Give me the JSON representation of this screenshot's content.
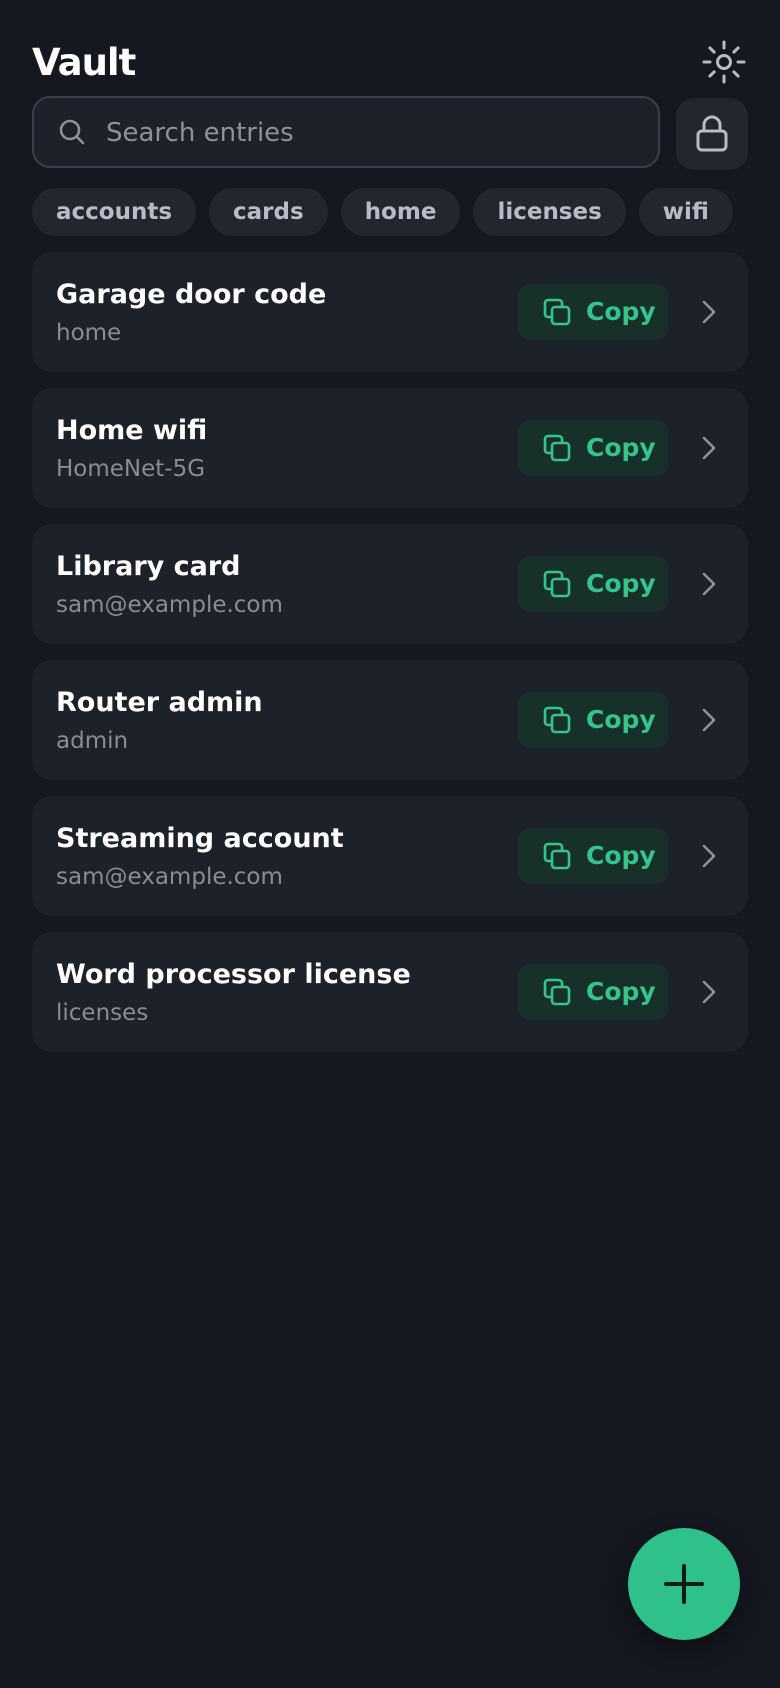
{
  "header": {
    "title": "Vault"
  },
  "search": {
    "placeholder": "Search entries",
    "value": ""
  },
  "filters": [
    "accounts",
    "cards",
    "home",
    "licenses",
    "wifi"
  ],
  "entries": [
    {
      "title": "Garage door code",
      "subtitle": "home",
      "copy_label": "Copy"
    },
    {
      "title": "Home wifi",
      "subtitle": "HomeNet-5G",
      "copy_label": "Copy"
    },
    {
      "title": "Library card",
      "subtitle": "sam@example.com",
      "copy_label": "Copy"
    },
    {
      "title": "Router admin",
      "subtitle": "admin",
      "copy_label": "Copy"
    },
    {
      "title": "Streaming account",
      "subtitle": "sam@example.com",
      "copy_label": "Copy"
    },
    {
      "title": "Word processor license",
      "subtitle": "licenses",
      "copy_label": "Copy"
    }
  ],
  "icons": {
    "theme": "sun-icon",
    "search": "search-icon",
    "lock": "lock-icon",
    "copy": "copy-icon",
    "chevron": "chevron-right-icon",
    "add": "plus-icon"
  },
  "colors": {
    "background": "#151820",
    "card": "#1d2129",
    "accent": "#2ec28a",
    "copy_text": "#34c58c",
    "copy_bg": "#17302a",
    "muted_text": "#878c96"
  }
}
